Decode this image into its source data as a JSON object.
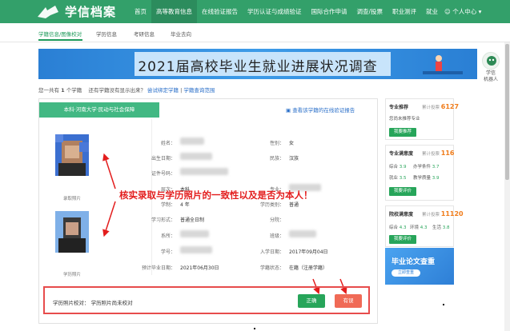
{
  "header": {
    "brand": "学信档案",
    "nav": [
      "首页",
      "高等教育信息",
      "在线验证报告",
      "学历认证与成绩验证",
      "国际合作申请",
      "调查/投票",
      "职业测评",
      "就业"
    ],
    "active_nav": 1,
    "user_center": "个人中心 ▾"
  },
  "subnav": {
    "items": [
      "学籍信息/图像校对",
      "学历信息",
      "考研信息",
      "毕业去向"
    ],
    "active": 0
  },
  "banner": {
    "title": "2021届高校毕业生就业进展状况调查"
  },
  "robot": {
    "label": "学信\n机器人"
  },
  "infoline": {
    "prefix": "您一共有",
    "count": "1",
    "suffix": "个学籍",
    "question": "还有学籍没有显示出来？",
    "link1": "尝试绑定学籍",
    "sep": "|",
    "link2": "学籍查询范围"
  },
  "record": {
    "tab": "本科·河南大学·民动与社会保障",
    "report_link": "查看该学籍的在线验证报告",
    "photo1_caption": "录取照片",
    "photo2_caption": "学历照片",
    "fields_left": [
      {
        "label": "姓名：",
        "value": ""
      },
      {
        "label": "出生日期：",
        "value": ""
      },
      {
        "label": "证件号码：",
        "value": ""
      },
      {
        "label": "层次：",
        "value": "本科"
      },
      {
        "label": "学制：",
        "value": "4 年"
      },
      {
        "label": "学习形式：",
        "value": "普通全日制"
      },
      {
        "label": "系所：",
        "value": ""
      },
      {
        "label": "学号：",
        "value": ""
      },
      {
        "label": "预计毕业日期：",
        "value": "2021年06月30日"
      }
    ],
    "fields_right": [
      {
        "label": "性别：",
        "value": "女"
      },
      {
        "label": "民族：",
        "value": "汉族"
      },
      {
        "label": "专业：",
        "value": ""
      },
      {
        "label": "学历类别：",
        "value": "普通"
      },
      {
        "label": "分院：",
        "value": ""
      },
      {
        "label": "班级：",
        "value": ""
      },
      {
        "label": "入学日期：",
        "value": "2017年09月04日"
      },
      {
        "label": "学籍状态：",
        "value": "在籍（注册学籍）"
      }
    ],
    "callout": "核实录取与学历照片的一致性以及是否为本人！",
    "verify_text": "学历照片校对：   学历照片尚未校对",
    "btn_ok": "正确",
    "btn_err": "有误"
  },
  "sidebar": {
    "cards": [
      {
        "title": "专业推荐",
        "count_label": "累计投票",
        "count": "6127",
        "sub": "您尚未推荐专业",
        "button": "我要推荐",
        "ratings": []
      },
      {
        "title": "专业满意度",
        "count_label": "累计投票",
        "count": "116",
        "sub": "",
        "button": "我要评价",
        "ratings": [
          {
            "name": "综合",
            "score": "3.9"
          },
          {
            "name": "办学条件",
            "score": "3.7"
          },
          {
            "name": "就业",
            "score": "3.5"
          },
          {
            "name": "教学质量",
            "score": "3.9"
          }
        ]
      },
      {
        "title": "院校满意度",
        "count_label": "累计投票",
        "count": "11120",
        "sub": "",
        "button": "我要评价",
        "ratings": [
          {
            "name": "综合",
            "score": "4.3"
          },
          {
            "name": "环境",
            "score": "4.3"
          },
          {
            "name": "生活",
            "score": "3.8"
          }
        ]
      }
    ],
    "ad": {
      "title": "毕业论文查重",
      "button": "立即查重"
    }
  },
  "colors": {
    "brand_green": "#33a06a",
    "accent_red": "#e31d1d",
    "link_blue": "#2a6fc9",
    "orange": "#f07c1a"
  }
}
